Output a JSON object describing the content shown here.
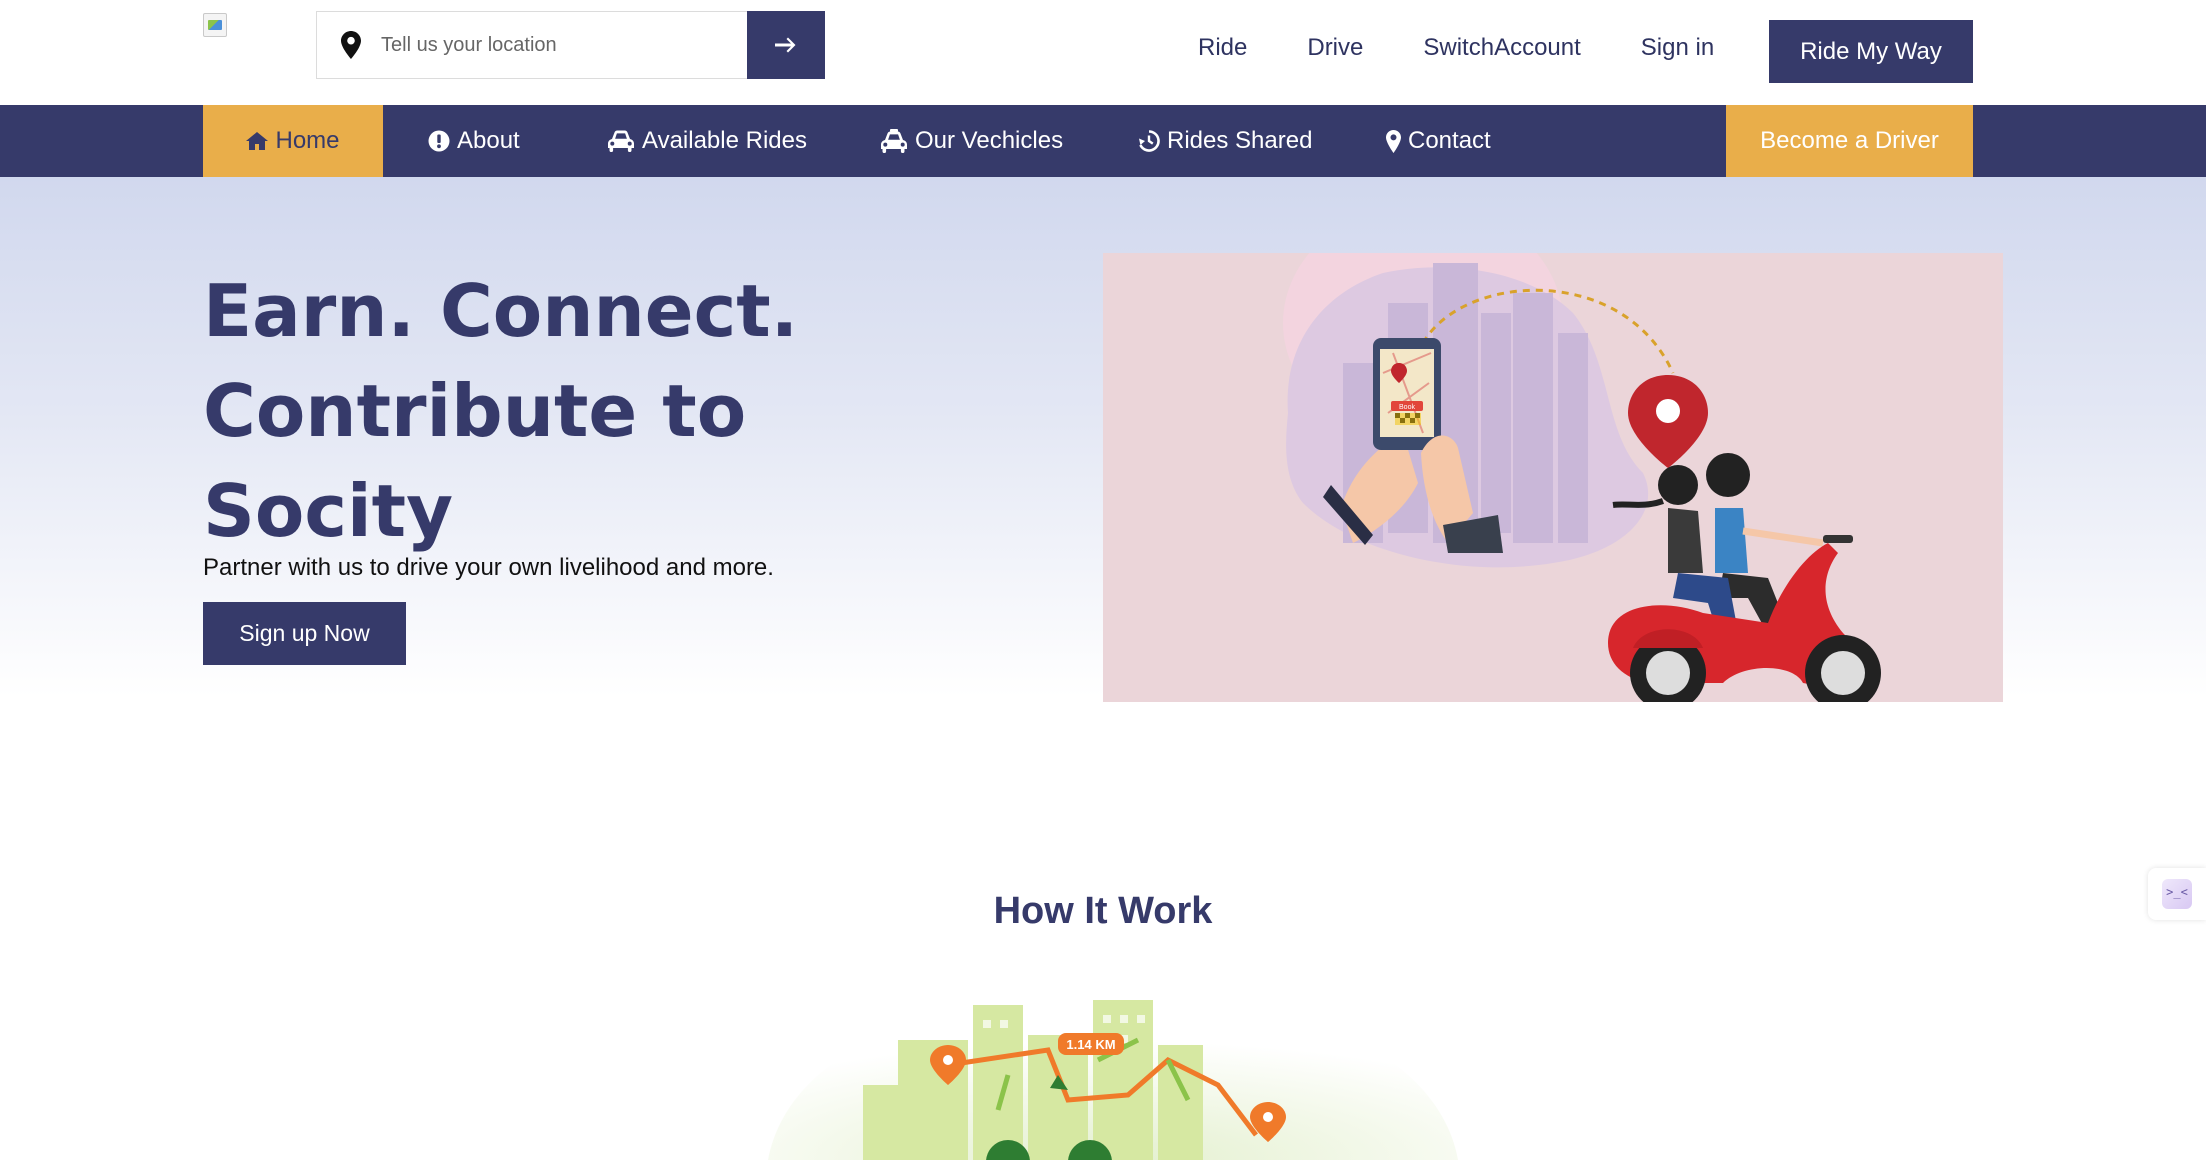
{
  "header": {
    "search": {
      "placeholder": "Tell us your location"
    },
    "links": [
      {
        "label": "Ride"
      },
      {
        "label": "Drive"
      },
      {
        "label": "SwitchAccount"
      },
      {
        "label": "Sign in"
      }
    ],
    "cta_label": "Ride My Way"
  },
  "nav": {
    "items": [
      {
        "label": "Home",
        "icon": "home-icon",
        "active": true
      },
      {
        "label": "About",
        "icon": "info-icon"
      },
      {
        "label": "Available Rides",
        "icon": "car-icon"
      },
      {
        "label": "Our Vechicles",
        "icon": "taxi-icon"
      },
      {
        "label": "Rides Shared",
        "icon": "history-icon"
      },
      {
        "label": "Contact",
        "icon": "map-marker-icon"
      }
    ],
    "become_driver_label": "Become a Driver"
  },
  "hero": {
    "title_line1": "Earn. Connect.",
    "title_line2": "Contribute to",
    "title_line3": "Socity",
    "subtitle": "Partner with us to drive your own livelihood and more.",
    "cta_label": "Sign up Now",
    "illustration_badge": "Book"
  },
  "how_it_works": {
    "title": "How It Work",
    "distance_label": "1.14 KM"
  },
  "side_widget": {
    "label": ">_<"
  },
  "colors": {
    "primary": "#363a6a",
    "accent": "#e9ae4a",
    "hero_bg_top": "#d1d8ee",
    "illustration_bg": "#ebd5d9"
  }
}
